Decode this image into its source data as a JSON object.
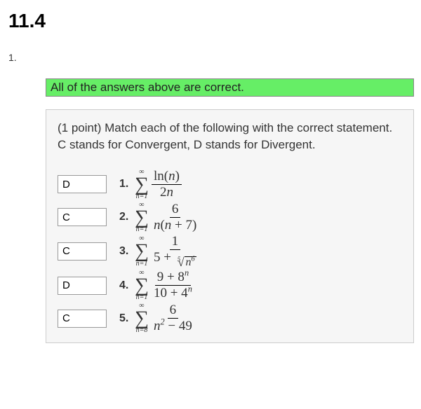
{
  "section_title": "11.4",
  "question_number": "1.",
  "feedback": "All of the answers above are correct.",
  "prompt": "(1 point) Match each of the following with the correct statement. C stands for Convergent, D stands for Divergent.",
  "items": [
    {
      "answer": "D",
      "num": "1.",
      "upper": "∞",
      "lower": "n=1",
      "numerator": "ln(n)",
      "denominator": "2n"
    },
    {
      "answer": "C",
      "num": "2.",
      "upper": "∞",
      "lower": "n=1",
      "numerator": "6",
      "denominator": "n(n + 7)"
    },
    {
      "answer": "C",
      "num": "3.",
      "upper": "∞",
      "lower": "n=1",
      "numerator": "1",
      "den_prefix": "5 + ",
      "root_index": "5",
      "root_arg_base": "n",
      "root_arg_exp": "6"
    },
    {
      "answer": "D",
      "num": "4.",
      "upper": "∞",
      "lower": "n=1",
      "num_a": "9 + 8",
      "num_exp": "n",
      "den_a": "10 + 4",
      "den_exp": "n"
    },
    {
      "answer": "C",
      "num": "5.",
      "upper": "∞",
      "lower": "n=8",
      "numerator": "6",
      "den_base": "n",
      "den_exp": "2",
      "den_tail": " − 49"
    }
  ]
}
